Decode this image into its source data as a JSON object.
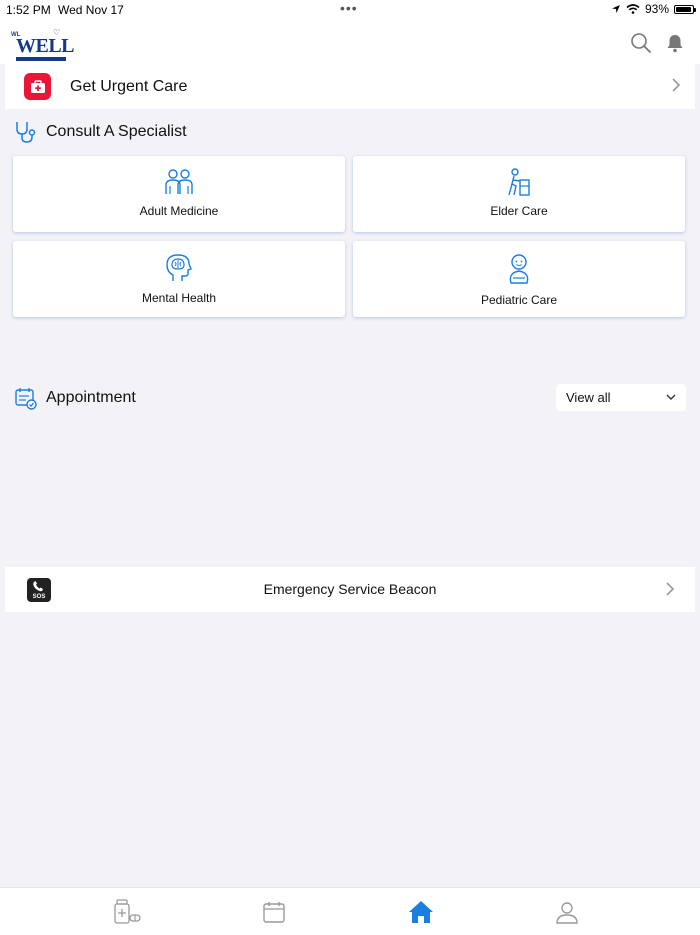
{
  "status_bar": {
    "time": "1:52 PM",
    "date": "Wed Nov 17",
    "battery": "93%",
    "battery_level": 0.93
  },
  "header": {
    "logo_text": "WELL",
    "logo_prefix": "WL",
    "icons": [
      "search-icon",
      "bell-icon"
    ]
  },
  "urgent_care": {
    "label": "Get Urgent Care",
    "accent": "#e8173a"
  },
  "specialist": {
    "title": "Consult A Specialist",
    "cards": [
      {
        "label": "Adult Medicine",
        "icon": "adults-icon"
      },
      {
        "label": "Elder Care",
        "icon": "elder-walker-icon"
      },
      {
        "label": "Mental Health",
        "icon": "brain-head-icon"
      },
      {
        "label": "Pediatric Care",
        "icon": "baby-icon"
      }
    ]
  },
  "appointment": {
    "title": "Appointment",
    "view_all": "View all"
  },
  "emergency": {
    "label": "Emergency Service Beacon",
    "badge": "SOS"
  },
  "tabbar": {
    "tabs": [
      {
        "icon": "pharmacy-icon",
        "active": false
      },
      {
        "icon": "calendar-icon",
        "active": false
      },
      {
        "icon": "home-icon",
        "active": true
      },
      {
        "icon": "profile-icon",
        "active": false
      }
    ],
    "active_color": "#1a7fe0"
  }
}
